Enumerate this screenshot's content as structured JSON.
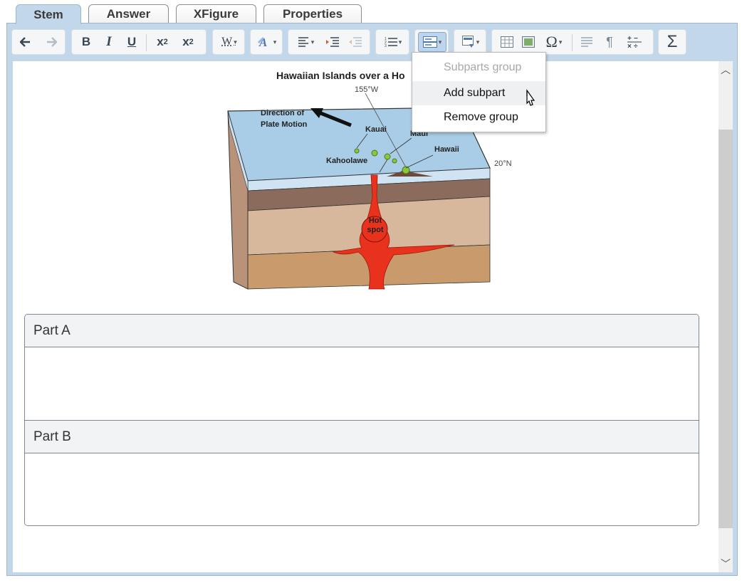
{
  "tabs": [
    {
      "label": "Stem",
      "active": true
    },
    {
      "label": "Answer",
      "active": false
    },
    {
      "label": "XFigure",
      "active": false
    },
    {
      "label": "Properties",
      "active": false
    }
  ],
  "toolbar": {
    "bold": "B",
    "italic": "I",
    "underline": "U",
    "subscript_base": "x",
    "subscript_mark": "2",
    "superscript_base": "x",
    "superscript_mark": "2",
    "word_style": "W",
    "special_char": "Ω",
    "sigma": "Σ",
    "pilcrow": "¶"
  },
  "dropdown": {
    "header": "Subparts group",
    "items": [
      "Add subpart",
      "Remove group"
    ]
  },
  "figure": {
    "title": "Hawaiian Islands over a Ho",
    "longitude": "155°W",
    "latitude": "20°N",
    "direction_label": "Direction of Plate Motion",
    "islands": [
      "Kauai",
      "Maui",
      "Hawaii",
      "Kahoolawe"
    ],
    "hotspot_label": "Hot spot"
  },
  "parts": [
    {
      "label": "Part A"
    },
    {
      "label": "Part B"
    }
  ],
  "colors": {
    "frame": "#c3d7ea",
    "ocean": "#a9cde6",
    "magma": "#e8321e"
  }
}
